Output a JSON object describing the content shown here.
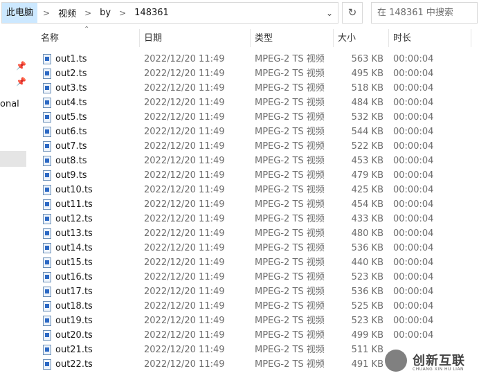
{
  "address": {
    "crumbs": [
      "此电脑",
      "视频",
      "by",
      "148361"
    ],
    "dropdown_icon": "chevron-down-icon",
    "refresh_icon": "refresh-icon"
  },
  "search": {
    "placeholder": "在 148361 中搜索"
  },
  "nav": {
    "partial_label": "onal"
  },
  "columns": {
    "name": "名称",
    "date": "日期",
    "type": "类型",
    "size": "大小",
    "duration": "时长"
  },
  "files": [
    {
      "name": "out1.ts",
      "date": "2022/12/20 11:49",
      "type": "MPEG-2 TS 视频",
      "size": "563 KB",
      "duration": "00:00:04"
    },
    {
      "name": "out2.ts",
      "date": "2022/12/20 11:49",
      "type": "MPEG-2 TS 视频",
      "size": "495 KB",
      "duration": "00:00:04"
    },
    {
      "name": "out3.ts",
      "date": "2022/12/20 11:49",
      "type": "MPEG-2 TS 视频",
      "size": "518 KB",
      "duration": "00:00:04"
    },
    {
      "name": "out4.ts",
      "date": "2022/12/20 11:49",
      "type": "MPEG-2 TS 视频",
      "size": "484 KB",
      "duration": "00:00:04"
    },
    {
      "name": "out5.ts",
      "date": "2022/12/20 11:49",
      "type": "MPEG-2 TS 视频",
      "size": "532 KB",
      "duration": "00:00:04"
    },
    {
      "name": "out6.ts",
      "date": "2022/12/20 11:49",
      "type": "MPEG-2 TS 视频",
      "size": "544 KB",
      "duration": "00:00:04"
    },
    {
      "name": "out7.ts",
      "date": "2022/12/20 11:49",
      "type": "MPEG-2 TS 视频",
      "size": "522 KB",
      "duration": "00:00:04"
    },
    {
      "name": "out8.ts",
      "date": "2022/12/20 11:49",
      "type": "MPEG-2 TS 视频",
      "size": "453 KB",
      "duration": "00:00:04"
    },
    {
      "name": "out9.ts",
      "date": "2022/12/20 11:49",
      "type": "MPEG-2 TS 视频",
      "size": "479 KB",
      "duration": "00:00:04"
    },
    {
      "name": "out10.ts",
      "date": "2022/12/20 11:49",
      "type": "MPEG-2 TS 视频",
      "size": "425 KB",
      "duration": "00:00:04"
    },
    {
      "name": "out11.ts",
      "date": "2022/12/20 11:49",
      "type": "MPEG-2 TS 视频",
      "size": "454 KB",
      "duration": "00:00:04"
    },
    {
      "name": "out12.ts",
      "date": "2022/12/20 11:49",
      "type": "MPEG-2 TS 视频",
      "size": "433 KB",
      "duration": "00:00:04"
    },
    {
      "name": "out13.ts",
      "date": "2022/12/20 11:49",
      "type": "MPEG-2 TS 视频",
      "size": "480 KB",
      "duration": "00:00:04"
    },
    {
      "name": "out14.ts",
      "date": "2022/12/20 11:49",
      "type": "MPEG-2 TS 视频",
      "size": "536 KB",
      "duration": "00:00:04"
    },
    {
      "name": "out15.ts",
      "date": "2022/12/20 11:49",
      "type": "MPEG-2 TS 视频",
      "size": "440 KB",
      "duration": "00:00:04"
    },
    {
      "name": "out16.ts",
      "date": "2022/12/20 11:49",
      "type": "MPEG-2 TS 视频",
      "size": "523 KB",
      "duration": "00:00:04"
    },
    {
      "name": "out17.ts",
      "date": "2022/12/20 11:49",
      "type": "MPEG-2 TS 视频",
      "size": "536 KB",
      "duration": "00:00:04"
    },
    {
      "name": "out18.ts",
      "date": "2022/12/20 11:49",
      "type": "MPEG-2 TS 视频",
      "size": "525 KB",
      "duration": "00:00:04"
    },
    {
      "name": "out19.ts",
      "date": "2022/12/20 11:49",
      "type": "MPEG-2 TS 视频",
      "size": "523 KB",
      "duration": "00:00:04"
    },
    {
      "name": "out20.ts",
      "date": "2022/12/20 11:49",
      "type": "MPEG-2 TS 视频",
      "size": "499 KB",
      "duration": "00:00:04"
    },
    {
      "name": "out21.ts",
      "date": "2022/12/20 11:49",
      "type": "MPEG-2 TS 视频",
      "size": "511 KB",
      "duration": ""
    },
    {
      "name": "out22.ts",
      "date": "2022/12/20 11:49",
      "type": "MPEG-2 TS 视频",
      "size": "491 KB",
      "duration": ""
    }
  ],
  "watermark": {
    "text": "创新互联",
    "subtext": "CHUANG XIN HU LIAN"
  },
  "colors": {
    "selection": "#cce8ff",
    "muted_text": "#6d6d6d",
    "icon_blue": "#2b68c4"
  }
}
